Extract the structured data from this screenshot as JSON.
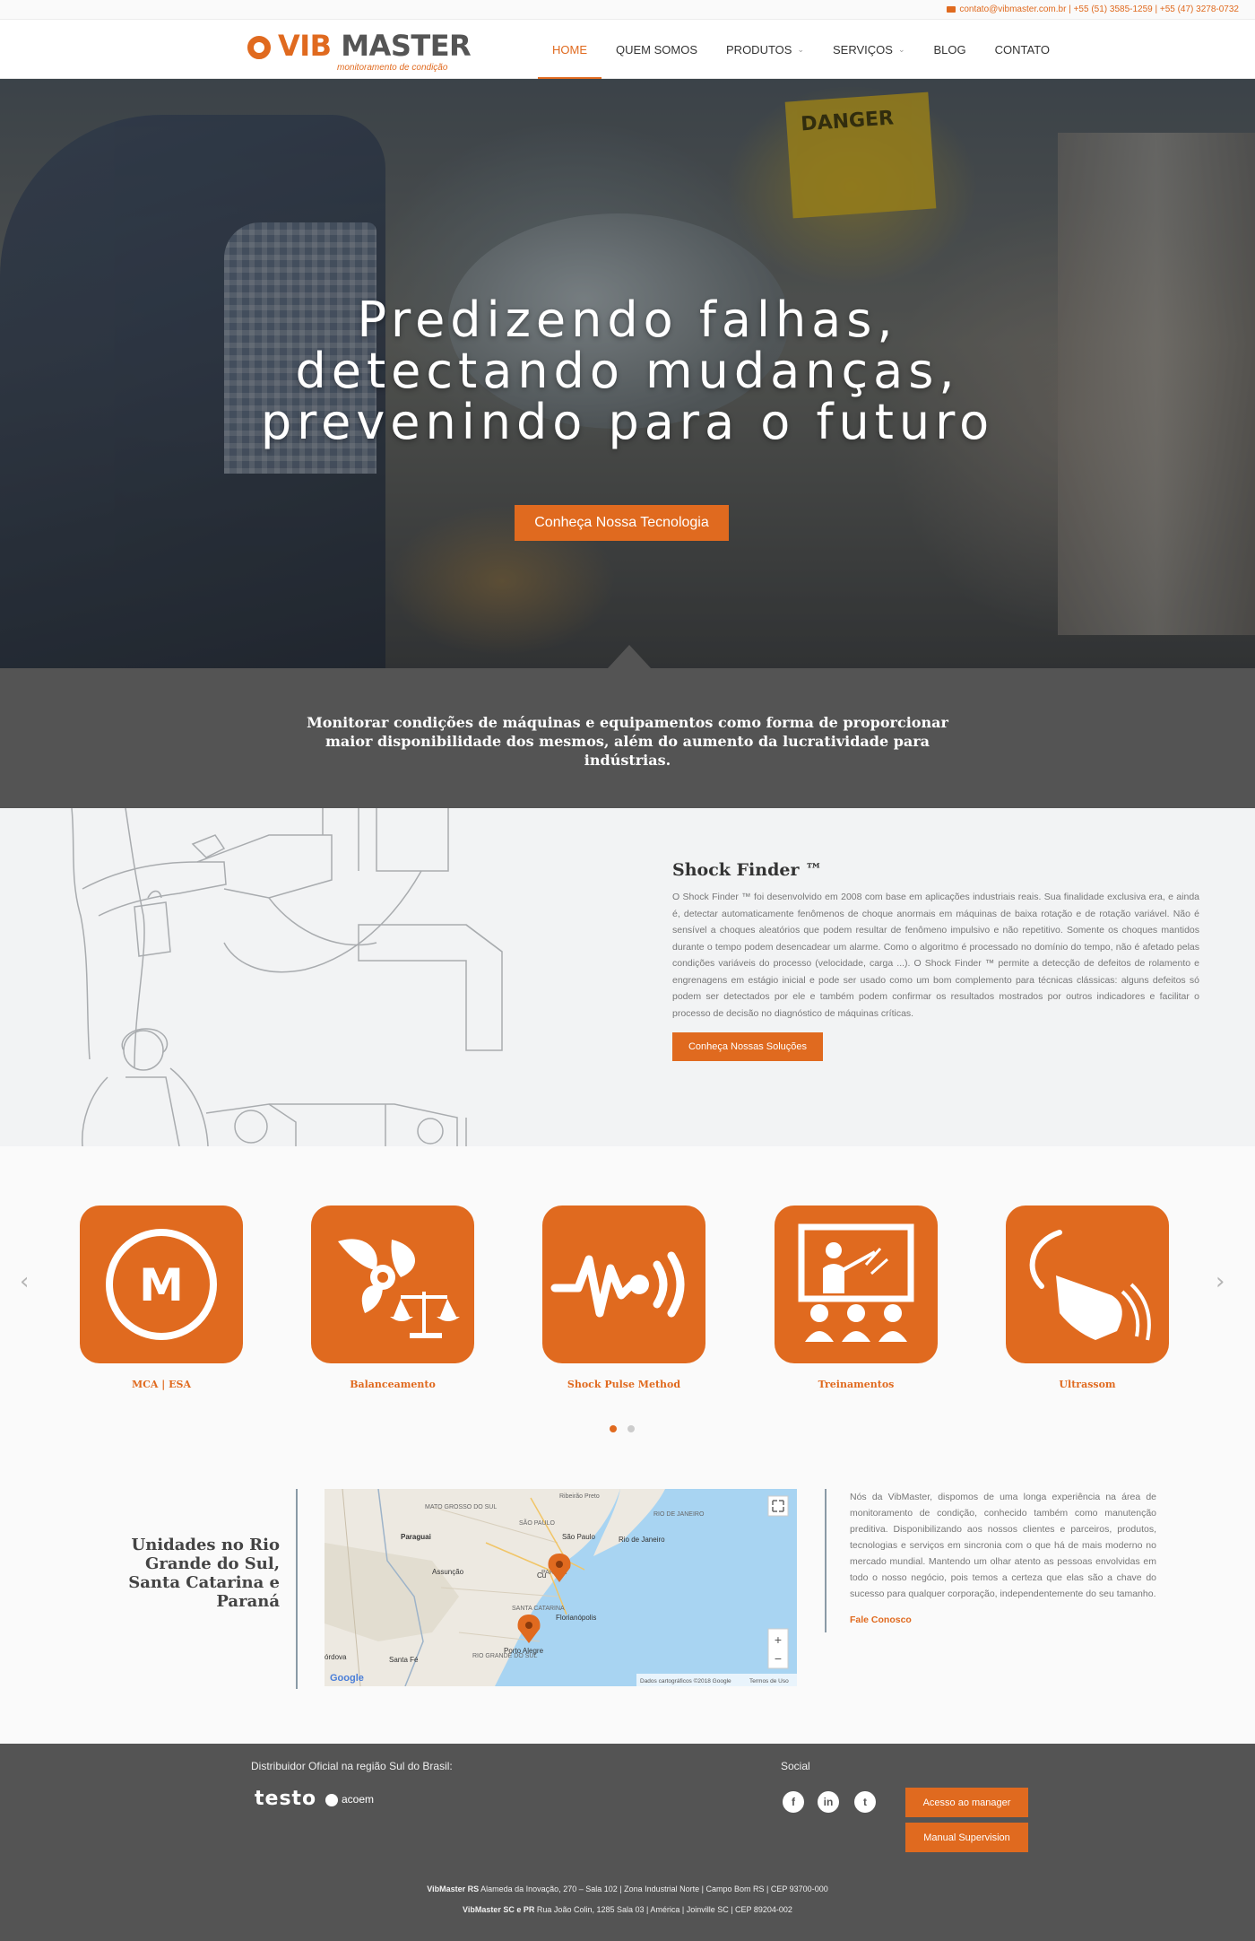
{
  "topbar": {
    "contact": "contato@vibmaster.com.br | +55 (51) 3585-1259 | +55 (47) 3278-0732"
  },
  "brand": {
    "name_part1": "VIB",
    "name_part2": "MASTER",
    "tagline": "monitoramento de condição",
    "accent": "#e06a1f"
  },
  "nav": {
    "items": [
      {
        "label": "HOME",
        "active": true
      },
      {
        "label": "QUEM SOMOS"
      },
      {
        "label": "PRODUTOS",
        "dropdown": true
      },
      {
        "label": "SERVIÇOS",
        "dropdown": true
      },
      {
        "label": "BLOG"
      },
      {
        "label": "CONTATO"
      }
    ]
  },
  "hero": {
    "line1": "Predizendo falhas,",
    "line2": "detectando mudanças,",
    "line3": "prevenindo para o futuro",
    "cta": "Conheça Nossa Tecnologia"
  },
  "statement": {
    "text": "Monitorar condições de máquinas e equipamentos como forma de proporcionar maior disponibilidade dos mesmos, além do aumento da lucratividade para indústrias."
  },
  "shock_finder": {
    "title": "Shock Finder ™",
    "body": "O Shock Finder ™ foi desenvolvido em 2008 com base em aplicações industriais reais. Sua finalidade exclusiva era, e ainda é, detectar automaticamente fenômenos de choque anormais em máquinas de baixa rotação e de rotação variável. Não é sensível a choques aleatórios que podem resultar de fenômeno impulsivo e não repetitivo. Somente os choques mantidos durante o tempo podem desencadear um alarme. Como o algoritmo é processado no domínio do tempo, não é afetado pelas condições variáveis do processo (velocidade, carga ...). O Shock Finder ™ permite a detecção de defeitos de rolamento e engrenagens em estágio inicial e pode ser usado como um bom complemento para técnicas clássicas: alguns defeitos só podem ser detectados por ele e também podem confirmar os resultados mostrados por outros indicadores e facilitar o processo de decisão no diagnóstico de máquinas críticas.",
    "button": "Conheça Nossas Soluções"
  },
  "services": {
    "items": [
      {
        "label": "MCA | ESA",
        "icon": "motor-m-icon"
      },
      {
        "label": "Balanceamento",
        "icon": "fan-scale-icon"
      },
      {
        "label": "Shock Pulse Method",
        "icon": "pulse-wave-icon"
      },
      {
        "label": "Treinamentos",
        "icon": "classroom-icon"
      },
      {
        "label": "Ultrassom",
        "icon": "ultrasound-probe-icon"
      }
    ],
    "page_count": 2,
    "active_page": 1
  },
  "units": {
    "title": "Unidades no Rio Grande do Sul, Santa Catarina e Paraná",
    "about": "Nós da VibMaster, dispomos de uma longa experiência na área de monitoramento de condição, conhecido também como manutenção preditiva. Disponibilizando aos nossos clientes e parceiros, produtos, tecnologias e serviços em sincronia com o que há de mais moderno no mercado mundial. Mantendo um olhar atento as pessoas envolvidas em todo o nosso negócio, pois temos a certeza que elas são a chave do sucesso para qualquer corporação, independentemente do seu tamanho.",
    "contact_link": "Fale Conosco",
    "map": {
      "labels": [
        "Ribeirão Preto",
        "MATO GROSSO DO SUL",
        "SÃO PAULO",
        "RIO DE JANEIRO",
        "Paraguai",
        "São Paulo",
        "Rio de Janeiro",
        "Assunção",
        "PARANÁ",
        "Cu",
        "SANTA CATARINA",
        "Florianópolis",
        "RIO GRANDE DO SUL",
        "Porto Alegre",
        "órdova",
        "Santa Fé"
      ],
      "attribution": "Dados cartográficos ©2018 Google",
      "terms": "Termos de Uso",
      "google": "Google",
      "zoom_in": "+",
      "zoom_out": "−"
    }
  },
  "footer": {
    "distributor": "Distribuidor Oficial na região Sul do Brasil:",
    "brand1": "testo",
    "brand2": "acoem",
    "social_title": "Social",
    "social": [
      {
        "icon": "facebook-icon",
        "glyph": "f"
      },
      {
        "icon": "linkedin-icon",
        "glyph": "in"
      },
      {
        "icon": "twitter-icon",
        "glyph": "t"
      }
    ],
    "btn_manager": "Acesso ao manager",
    "btn_manual": "Manual Supervision",
    "addr_rs_label": "VibMaster RS",
    "addr_rs": " Alameda da Inovação, 270 – Sala 102 | Zona Industrial Norte | Campo Bom RS | CEP 93700-000",
    "addr_sc_label": "VibMaster SC e PR",
    "addr_sc": " Rua João Colin, 1285 Sala 03 | América | Joinville SC | CEP 89204-002"
  }
}
